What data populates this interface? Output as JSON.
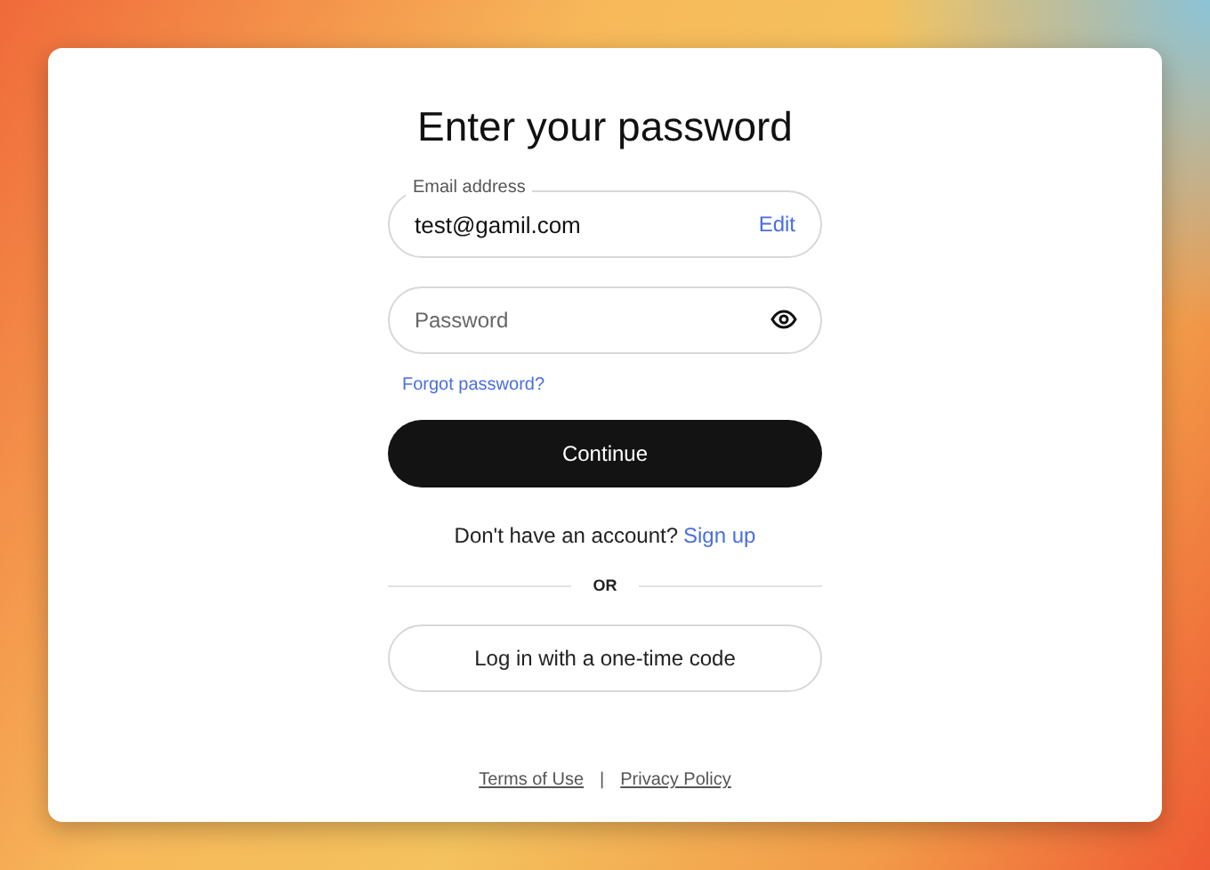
{
  "title": "Enter your password",
  "email": {
    "label": "Email address",
    "value": "test@gamil.com",
    "action": "Edit"
  },
  "password": {
    "placeholder": "Password"
  },
  "forgot_link": "Forgot password?",
  "continue_button": "Continue",
  "signup": {
    "text": "Don't have an account?",
    "link": "Sign up"
  },
  "divider": "OR",
  "otp_button": "Log in with a one-time code",
  "footer": {
    "links": [
      "Terms of Use",
      "Privacy Policy"
    ],
    "separator": "|"
  }
}
